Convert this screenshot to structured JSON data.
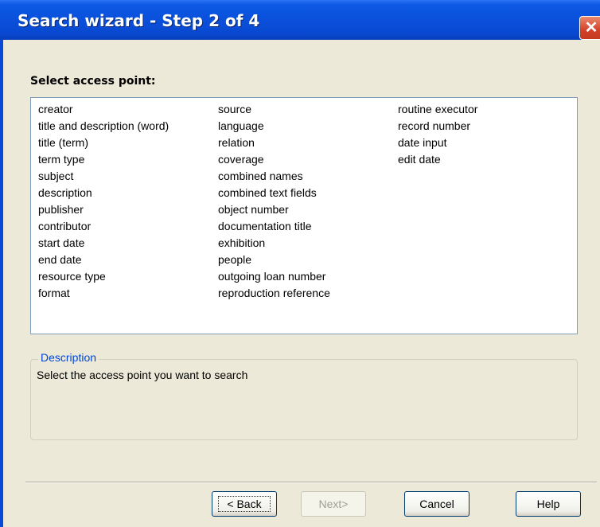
{
  "window": {
    "title": "Search wizard - Step 2 of 4",
    "close_glyph": "✕"
  },
  "access_point": {
    "label": "Select access point:",
    "columns": [
      [
        "creator",
        "title and description (word)",
        "title (term)",
        "term type",
        "subject",
        "description",
        "publisher",
        "contributor",
        "start date",
        "end date",
        "resource type",
        "format"
      ],
      [
        "source",
        "language",
        "relation",
        "coverage",
        "combined names",
        "combined text fields",
        "object number",
        "documentation title",
        "exhibition",
        "people",
        "outgoing loan number",
        "reproduction reference"
      ],
      [
        "routine executor",
        "record number",
        "date input",
        "edit date"
      ]
    ]
  },
  "description": {
    "legend": "Description",
    "text": "Select the access point you want to search"
  },
  "buttons": {
    "back": "< Back",
    "next": "Next>",
    "cancel": "Cancel",
    "help": "Help"
  },
  "colors": {
    "titlebar": "#0a4fd9",
    "client_background": "#ece9d8",
    "legend_text": "#0046d5",
    "close_button": "#d5412a"
  },
  "icons": {
    "close": "close-icon"
  }
}
